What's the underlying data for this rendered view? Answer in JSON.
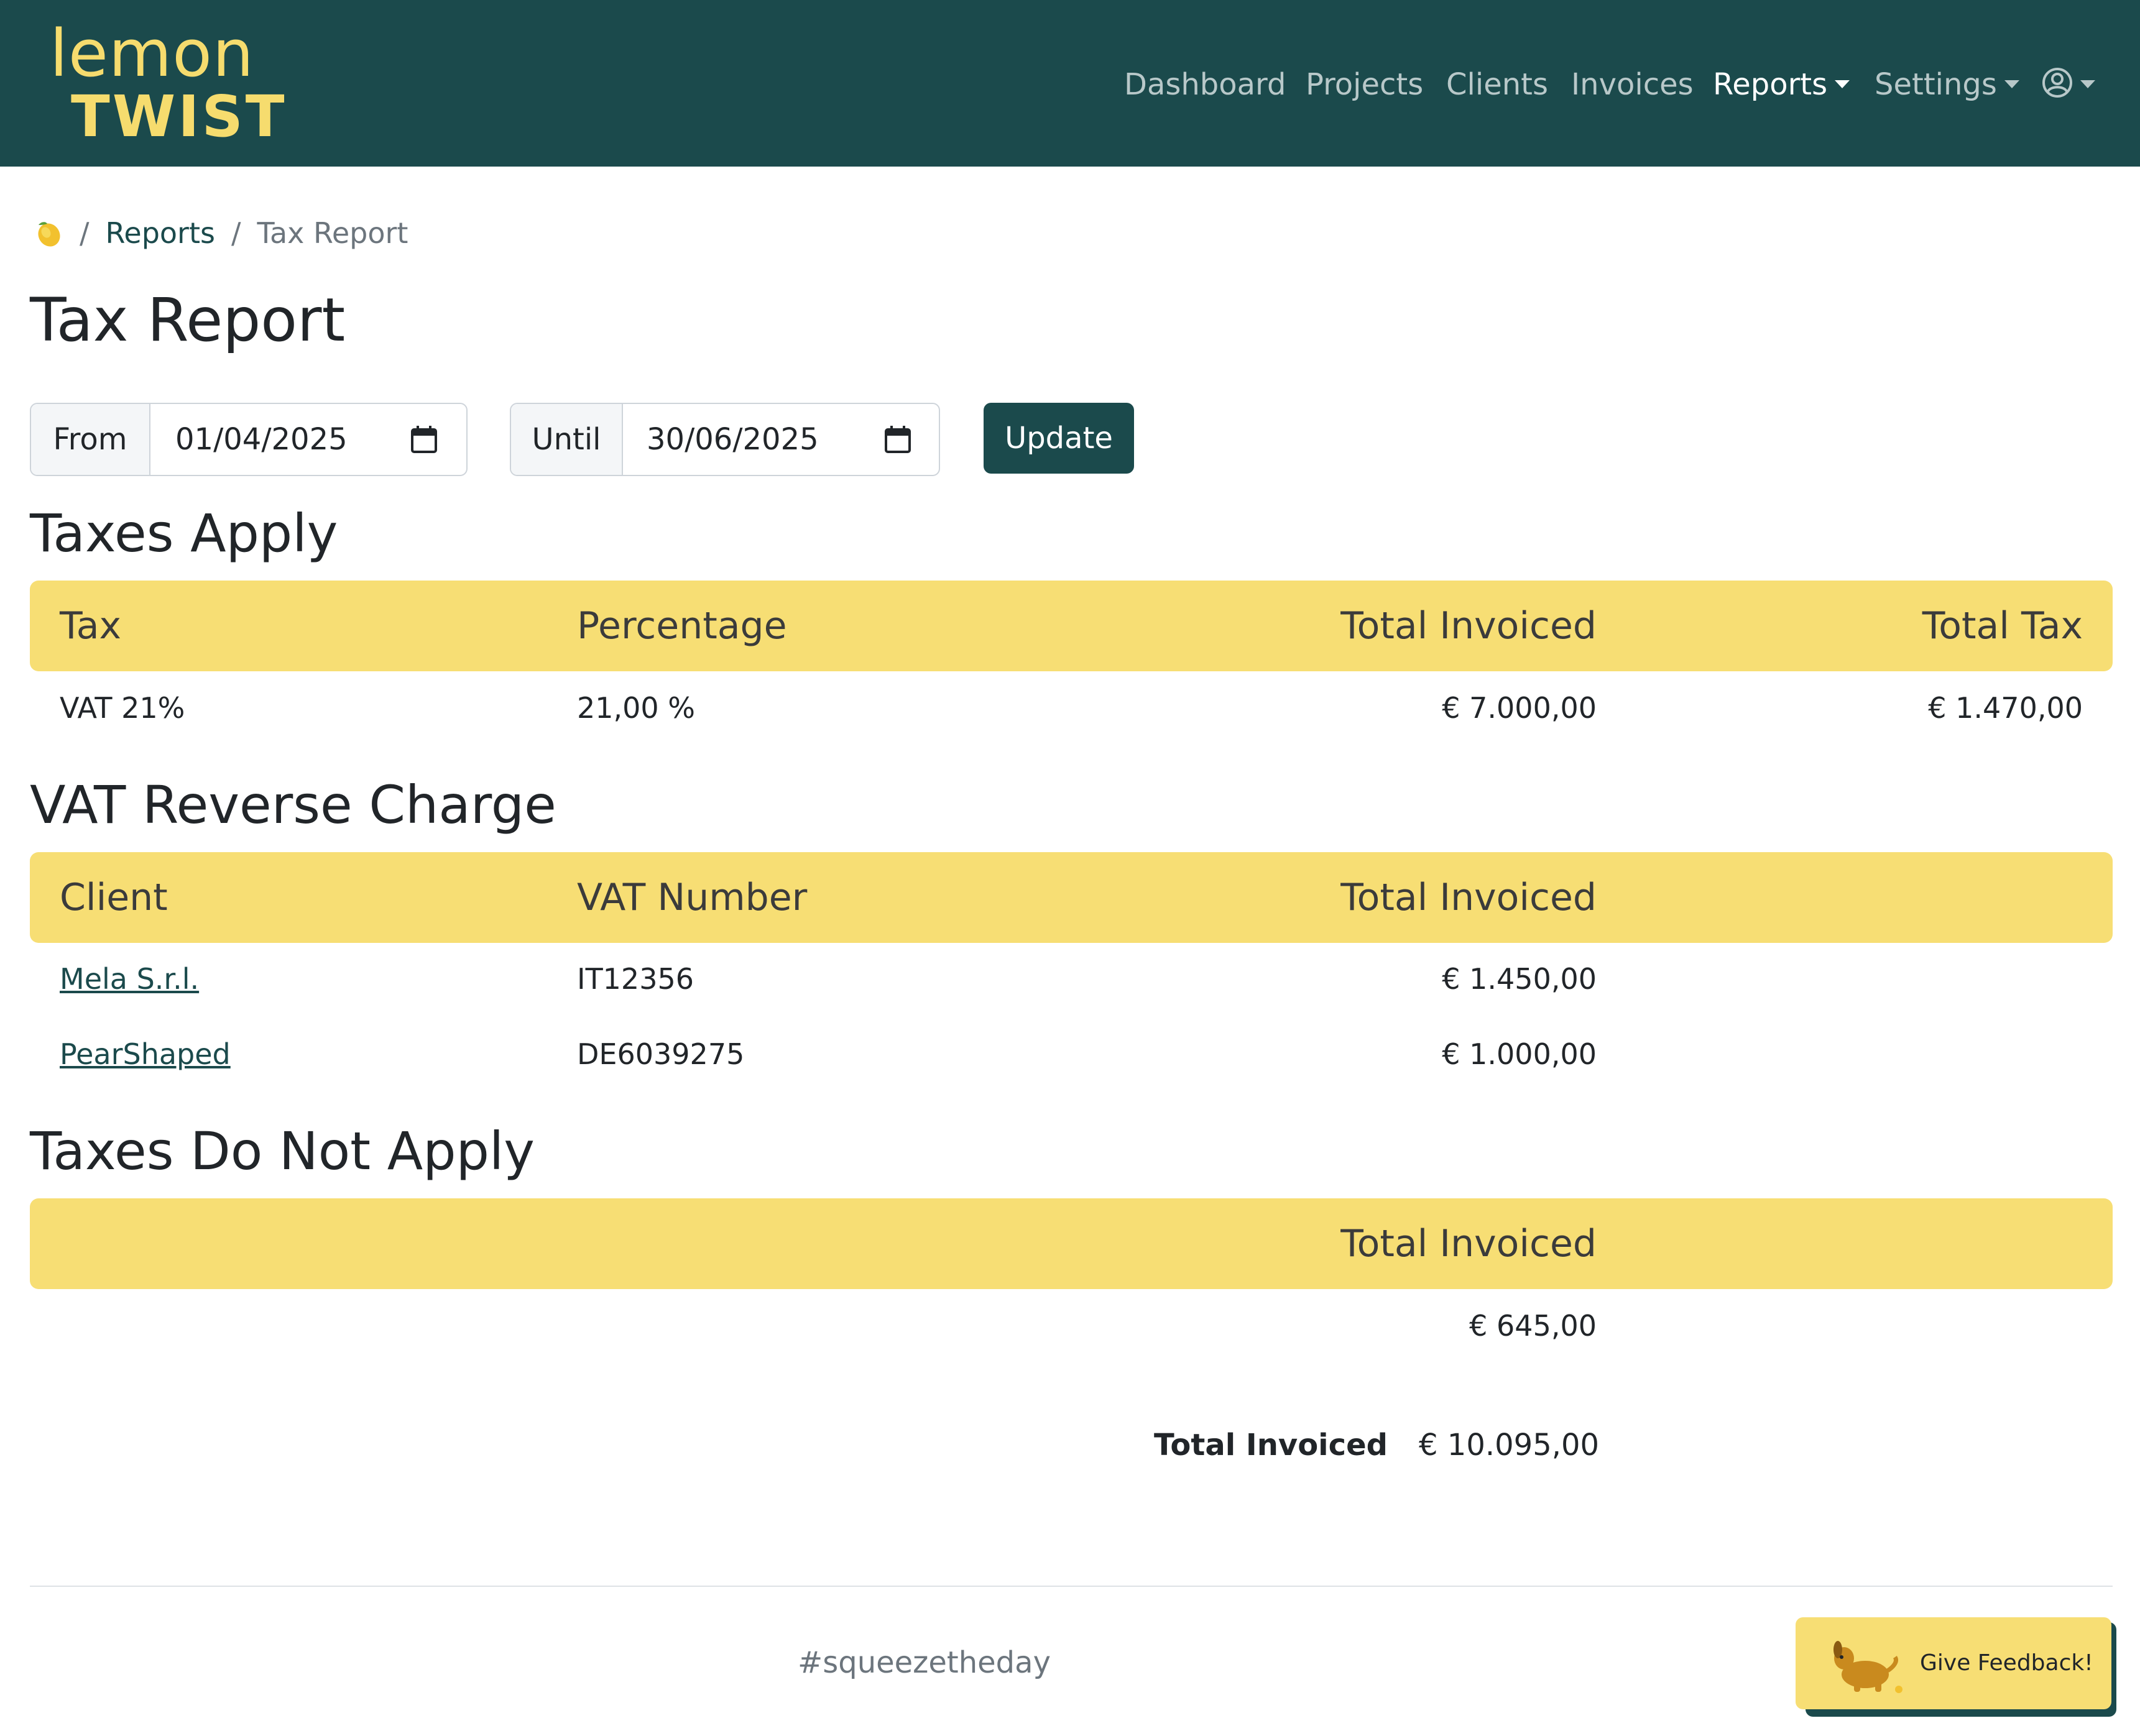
{
  "app": {
    "logo_top": "lemon",
    "logo_bottom": "TWIST"
  },
  "nav": {
    "dashboard": "Dashboard",
    "projects": "Projects",
    "clients": "Clients",
    "invoices": "Invoices",
    "reports": "Reports",
    "settings": "Settings"
  },
  "breadcrumb": {
    "sep": "/",
    "reports": "Reports",
    "current": "Tax Report"
  },
  "page": {
    "title": "Tax Report"
  },
  "filters": {
    "from_label": "From",
    "from_value": "01/04/2025",
    "until_label": "Until",
    "until_value": "30/06/2025",
    "update_label": "Update"
  },
  "taxes_apply": {
    "title": "Taxes Apply",
    "headers": {
      "tax": "Tax",
      "percentage": "Percentage",
      "total_invoiced": "Total Invoiced",
      "total_tax": "Total Tax"
    },
    "rows": [
      {
        "tax": "VAT 21%",
        "percentage": "21,00 %",
        "total_invoiced": "€ 7.000,00",
        "total_tax": "€ 1.470,00"
      }
    ]
  },
  "reverse_charge": {
    "title": "VAT Reverse Charge",
    "headers": {
      "client": "Client",
      "vat_number": "VAT Number",
      "total_invoiced": "Total Invoiced"
    },
    "rows": [
      {
        "client": "Mela S.r.l.",
        "vat_number": "IT12356",
        "total_invoiced": "€ 1.450,00"
      },
      {
        "client": "PearShaped",
        "vat_number": "DE6039275",
        "total_invoiced": "€ 1.000,00"
      }
    ]
  },
  "taxes_not_apply": {
    "title": "Taxes Do Not Apply",
    "headers": {
      "total_invoiced": "Total Invoiced"
    },
    "rows": [
      {
        "total_invoiced": "€ 645,00"
      }
    ]
  },
  "summary": {
    "total_label": "Total Invoiced",
    "total_value": "€ 10.095,00"
  },
  "footer": {
    "tagline": "#squeezetheday",
    "feedback_label": "Give Feedback!"
  },
  "colors": {
    "brand_dark": "#1b4a4c",
    "brand_yellow": "#f7de74",
    "logo_yellow": "#f6dc6e"
  },
  "icons": {
    "breadcrumb_home": "lemon-icon",
    "date": "calendar-icon",
    "user": "user-circle-icon",
    "feedback": "dog-icon"
  }
}
